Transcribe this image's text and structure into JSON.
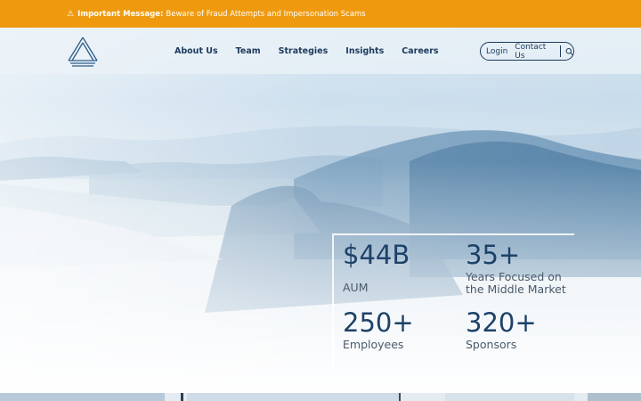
{
  "alert": {
    "icon": "warning-icon",
    "bold": "Important Message:",
    "text": "Beware of Fraud Attempts and Impersonation Scams",
    "color": "#ef9a0e"
  },
  "nav": {
    "links": [
      "About Us",
      "Team",
      "Strategies",
      "Insights",
      "Careers"
    ],
    "login": "Login",
    "contact": "Contact Us",
    "search_icon": "search-icon",
    "color": "#1d3a5c"
  },
  "stats": [
    {
      "value": "$44B",
      "label": "AUM"
    },
    {
      "value": "35+",
      "label": "Years Focused on the Middle Market"
    },
    {
      "value": "250+",
      "label": "Employees"
    },
    {
      "value": "320+",
      "label": "Sponsors"
    }
  ]
}
